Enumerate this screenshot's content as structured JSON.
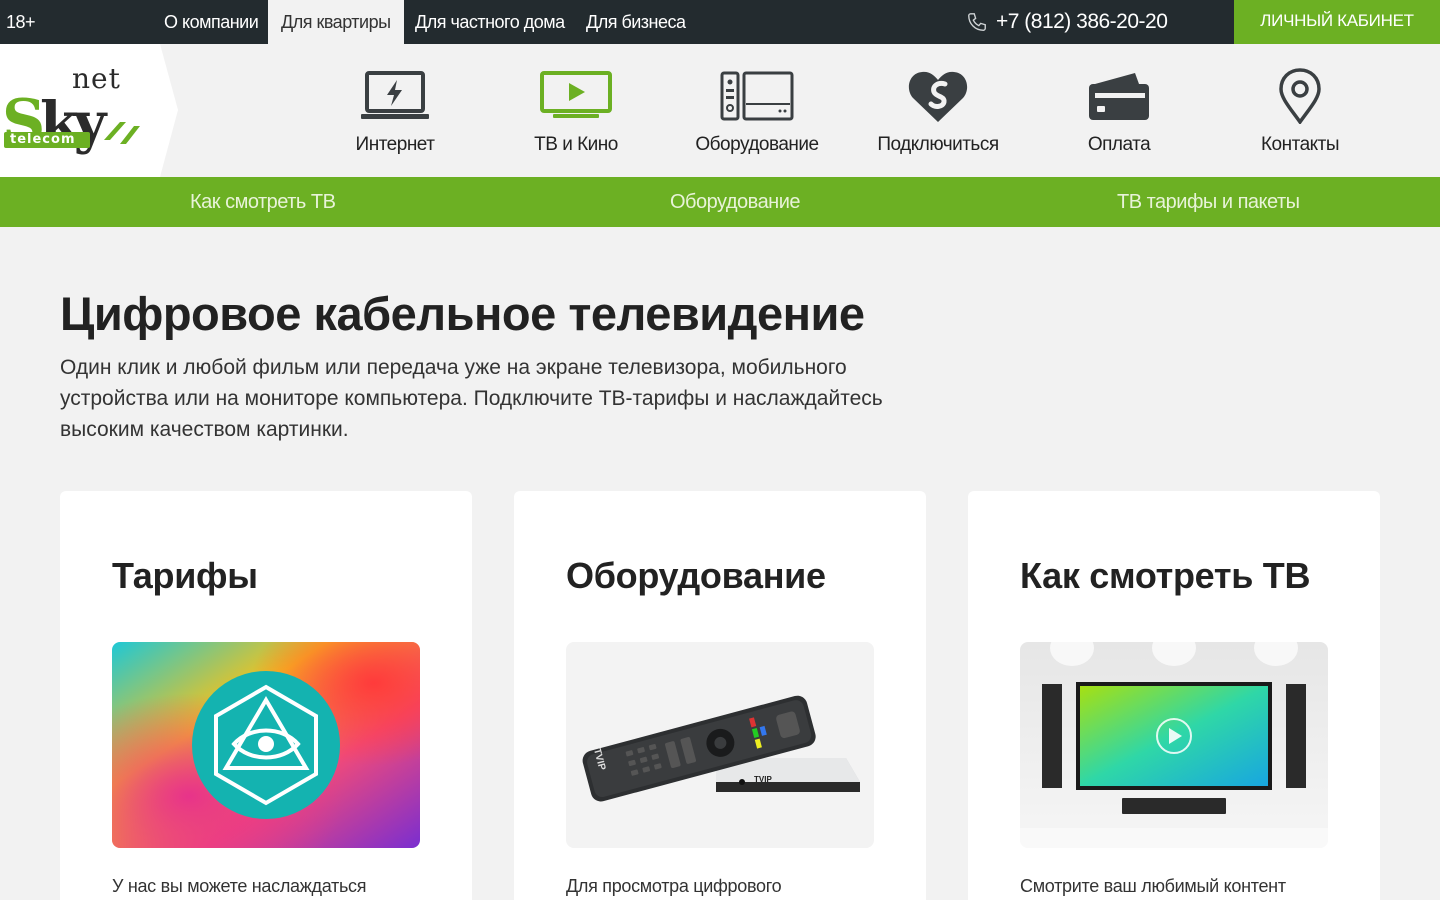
{
  "topbar": {
    "age": "18+",
    "links": [
      {
        "label": "О компании"
      },
      {
        "label": "Для квартиры"
      },
      {
        "label": "Для частного дома"
      },
      {
        "label": "Для бизнеса"
      }
    ],
    "active_index": 1,
    "phone": "+7 (812) 386-20-20",
    "cabinet": "ЛИЧНЫЙ КАБИНЕТ"
  },
  "logo": {
    "sky": "Sky",
    "net": "net",
    "telecom": "telecom"
  },
  "menu": [
    {
      "label": "Интернет",
      "icon": "laptop-icon"
    },
    {
      "label": "ТВ и Кино",
      "icon": "tv-icon"
    },
    {
      "label": "Оборудование",
      "icon": "equipment-icon"
    },
    {
      "label": "Подключиться",
      "icon": "heart-connect-icon"
    },
    {
      "label": "Оплата",
      "icon": "wallet-icon"
    },
    {
      "label": "Контакты",
      "icon": "map-pin-icon"
    }
  ],
  "subnav": [
    {
      "label": "Как смотреть ТВ"
    },
    {
      "label": "Оборудование"
    },
    {
      "label": "ТВ тарифы и пакеты"
    }
  ],
  "main": {
    "title": "Цифровое кабельное телевидение",
    "description": "Один клик и любой фильм или передача уже на экране телевизора, мобильного устройства или на мониторе компьютера. Подключите ТВ-тарифы и наслаждайтесь высоким качеством картинки."
  },
  "cards": [
    {
      "title": "Тарифы",
      "text": "У нас вы можете наслаждаться",
      "image": "eye-emblem-image"
    },
    {
      "title": "Оборудование",
      "text": "Для просмотра цифрового",
      "image": "remote-and-settop-box-image",
      "brand": "TVIP"
    },
    {
      "title": "Как смотреть ТВ",
      "text": "Смотрите ваш любимый контент",
      "image": "tv-on-wall-image"
    }
  ],
  "colors": {
    "green": "#6cb023",
    "dark": "#232b2f",
    "background": "#f2f2f2"
  }
}
